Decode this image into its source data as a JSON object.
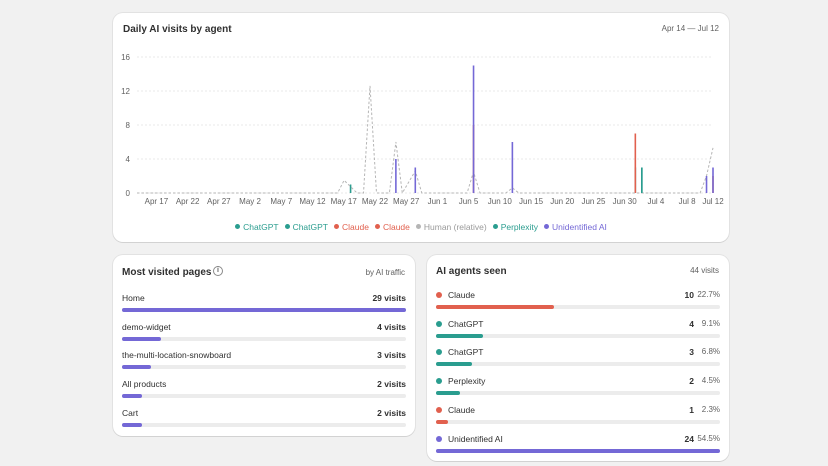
{
  "colors": {
    "chatgpt": "#2a9d8f",
    "claude": "#e1604e",
    "human": "#b5b5b5",
    "perplexity": "#2a9d8f",
    "unidentified": "#7468d6",
    "bar_blue": "#7468d6"
  },
  "chart_card": {
    "title": "Daily AI visits by agent",
    "range": "Apr 14 — Jul 12"
  },
  "chart_data": {
    "type": "line",
    "title": "Daily AI visits by agent",
    "x_range": [
      "2025-04-14",
      "2025-07-12"
    ],
    "ylim": [
      0,
      16
    ],
    "y_ticks": [
      0,
      4,
      8,
      12,
      16
    ],
    "x_tick_labels": [
      "Apr 17",
      "Apr 22",
      "Apr 27",
      "May 2",
      "May 7",
      "May 12",
      "May 17",
      "May 22",
      "May 27",
      "Jun 1",
      "Jun 5",
      "Jun 10",
      "Jun 15",
      "Jun 20",
      "Jun 25",
      "Jun 30",
      "Jul 4",
      "Jul 8",
      "Jul 12"
    ],
    "grid": true,
    "legend_position": "bottom",
    "series": [
      {
        "name": "ChatGPT",
        "color": "#2a9d8f",
        "style": "spike",
        "points": [
          {
            "x": "2025-05-17",
            "y": 1
          },
          {
            "x": "2025-06-30",
            "y": 3
          }
        ]
      },
      {
        "name": "ChatGPT",
        "color": "#2a9d8f",
        "style": "spike",
        "points": [
          {
            "x": "2025-07-01",
            "y": 3
          }
        ]
      },
      {
        "name": "Claude",
        "color": "#e1604e",
        "style": "spike",
        "points": [
          {
            "x": "2025-06-05",
            "y": 8
          },
          {
            "x": "2025-06-30",
            "y": 7
          }
        ]
      },
      {
        "name": "Claude",
        "color": "#e1604e",
        "style": "spike",
        "points": [
          {
            "x": "2025-07-12",
            "y": 2
          }
        ]
      },
      {
        "name": "Human (relative)",
        "color": "#b5b5b5",
        "style": "dashed",
        "points": [
          {
            "x": "2025-05-15",
            "y": 0
          },
          {
            "x": "2025-05-16",
            "y": 1.5
          },
          {
            "x": "2025-05-18",
            "y": 0
          },
          {
            "x": "2025-05-19",
            "y": 0
          },
          {
            "x": "2025-05-20",
            "y": 12.6
          },
          {
            "x": "2025-05-21",
            "y": 0
          },
          {
            "x": "2025-05-23",
            "y": 0
          },
          {
            "x": "2025-05-24",
            "y": 6
          },
          {
            "x": "2025-05-25",
            "y": 0
          },
          {
            "x": "2025-05-27",
            "y": 2.6
          },
          {
            "x": "2025-05-28",
            "y": 0
          },
          {
            "x": "2025-06-04",
            "y": 0
          },
          {
            "x": "2025-06-05",
            "y": 2.5
          },
          {
            "x": "2025-06-06",
            "y": 0
          },
          {
            "x": "2025-06-10",
            "y": 0
          },
          {
            "x": "2025-06-11",
            "y": 0.6
          },
          {
            "x": "2025-06-12",
            "y": 0
          },
          {
            "x": "2025-07-10",
            "y": 0
          },
          {
            "x": "2025-07-11",
            "y": 2
          },
          {
            "x": "2025-07-12",
            "y": 5.3
          }
        ]
      },
      {
        "name": "Perplexity",
        "color": "#2a9d8f",
        "style": "spike",
        "points": [
          {
            "x": "2025-07-01",
            "y": 3
          }
        ]
      },
      {
        "name": "Unidentified AI",
        "color": "#7468d6",
        "style": "spike",
        "points": [
          {
            "x": "2025-05-24",
            "y": 4
          },
          {
            "x": "2025-05-27",
            "y": 3
          },
          {
            "x": "2025-06-05",
            "y": 15
          },
          {
            "x": "2025-06-11",
            "y": 6
          },
          {
            "x": "2025-07-11",
            "y": 2
          },
          {
            "x": "2025-07-12",
            "y": 3
          }
        ]
      }
    ]
  },
  "legend": [
    {
      "label": "ChatGPT",
      "color": "#2a9d8f"
    },
    {
      "label": "ChatGPT",
      "color": "#2a9d8f"
    },
    {
      "label": "Claude",
      "color": "#e1604e"
    },
    {
      "label": "Claude",
      "color": "#e1604e"
    },
    {
      "label": "Human (relative)",
      "color": "#b5b5b5"
    },
    {
      "label": "Perplexity",
      "color": "#2a9d8f"
    },
    {
      "label": "Unidentified AI",
      "color": "#7468d6"
    }
  ],
  "pages_card": {
    "title": "Most visited pages",
    "info_icon": "info-icon",
    "meta": "by AI traffic",
    "rows": [
      {
        "label": "Home",
        "value": "29 visits",
        "fraction": 1.0
      },
      {
        "label": "demo-widget",
        "value": "4 visits",
        "fraction": 0.138
      },
      {
        "label": "the-multi-location-snowboard",
        "value": "3 visits",
        "fraction": 0.103
      },
      {
        "label": "All products",
        "value": "2 visits",
        "fraction": 0.069
      },
      {
        "label": "Cart",
        "value": "2 visits",
        "fraction": 0.069
      }
    ]
  },
  "agents_card": {
    "title": "AI agents seen",
    "meta": "44 visits",
    "rows": [
      {
        "label": "Claude",
        "count": "10",
        "pct": "22.7%",
        "fraction": 0.417,
        "color": "#e1604e"
      },
      {
        "label": "ChatGPT",
        "count": "4",
        "pct": "9.1%",
        "fraction": 0.167,
        "color": "#2a9d8f"
      },
      {
        "label": "ChatGPT",
        "count": "3",
        "pct": "6.8%",
        "fraction": 0.125,
        "color": "#2a9d8f"
      },
      {
        "label": "Perplexity",
        "count": "2",
        "pct": "4.5%",
        "fraction": 0.083,
        "color": "#2a9d8f"
      },
      {
        "label": "Claude",
        "count": "1",
        "pct": "2.3%",
        "fraction": 0.042,
        "color": "#e1604e"
      },
      {
        "label": "Unidentified AI",
        "count": "24",
        "pct": "54.5%",
        "fraction": 1.0,
        "color": "#7468d6"
      }
    ]
  }
}
